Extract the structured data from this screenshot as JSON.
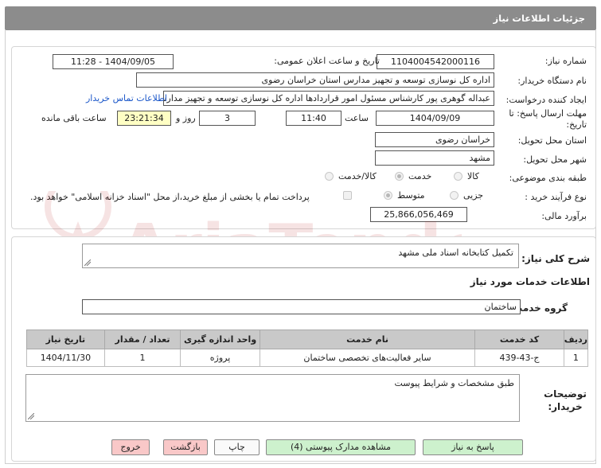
{
  "panel": {
    "title": "جزئیات اطلاعات نیاز"
  },
  "labels": {
    "need_number": "شماره نیاز:",
    "announce_datetime": "تاریخ و ساعت اعلان عمومی:",
    "buyer_org": "نام دستگاه خریدار:",
    "requester": "ایجاد کننده درخواست:",
    "deadline": "مهلت ارسال پاسخ: تا تاریخ:",
    "hour": "ساعت",
    "days_and": "روز و",
    "remaining": "ساعت باقی مانده",
    "province": "استان محل تحویل:",
    "city": "شهر محل تحویل:",
    "category": "طبقه بندی موضوعی:",
    "process_type": "نوع فرآیند خرید :",
    "budget": "برآورد مالی:",
    "general_desc": "شرح کلی نیاز:",
    "services_info": "اطلاعات خدمات مورد نیاز",
    "service_group": "گروه خدمت:",
    "buyer_notes": "توضیحات خریدار:"
  },
  "values": {
    "need_number": "1104004542000116",
    "announce_datetime": "1404/09/05 - 11:28",
    "buyer_org": "اداره کل نوسازی  توسعه و تجهیز مدارس استان خراسان رضوی",
    "requester": "عبداله گوهری پور کارشناس مسئول امور قراردادها  اداره کل نوسازی  توسعه و تجهیز مدارس استان خراسان رضوی",
    "buyer_contact_link": "اطلاعات تماس خریدار",
    "deadline_date": "1404/09/09",
    "deadline_time": "11:40",
    "days": "3",
    "remaining_time": "23:21:34",
    "province": "خراسان رضوی",
    "city": "مشهد",
    "budget": "25,866,056,469",
    "general_desc": "تکمیل کتابخانه اسناد ملی مشهد",
    "service_group": "ساختمان",
    "buyer_notes": "طبق مشخصات و شرایط پیوست"
  },
  "category_options": [
    {
      "label": "کالا",
      "checked": false
    },
    {
      "label": "خدمت",
      "checked": true
    },
    {
      "label": "کالا/خدمت",
      "checked": false
    }
  ],
  "process_options": [
    {
      "label": "جزیی",
      "checked": false
    },
    {
      "label": "متوسط",
      "checked": true
    }
  ],
  "treasury_note": "پرداخت تمام یا بخشی از مبلغ خرید،از محل \"اسناد خزانه اسلامی\" خواهد بود.",
  "table": {
    "headers": [
      "ردیف",
      "کد خدمت",
      "نام خدمت",
      "واحد اندازه گیری",
      "تعداد / مقدار",
      "تاریخ نیاز"
    ],
    "rows": [
      [
        "1",
        "ج-43-439",
        "سایر فعالیت‌های تخصصی ساختمان",
        "پروژه",
        "1",
        "1404/11/30"
      ]
    ]
  },
  "buttons": {
    "reply": "پاسخ به نیاز",
    "view_docs": "مشاهده مدارک پیوستی (4)",
    "print": "چاپ",
    "back": "بازگشت",
    "exit": "خروج"
  },
  "watermark_text": "AriaTender.neT"
}
